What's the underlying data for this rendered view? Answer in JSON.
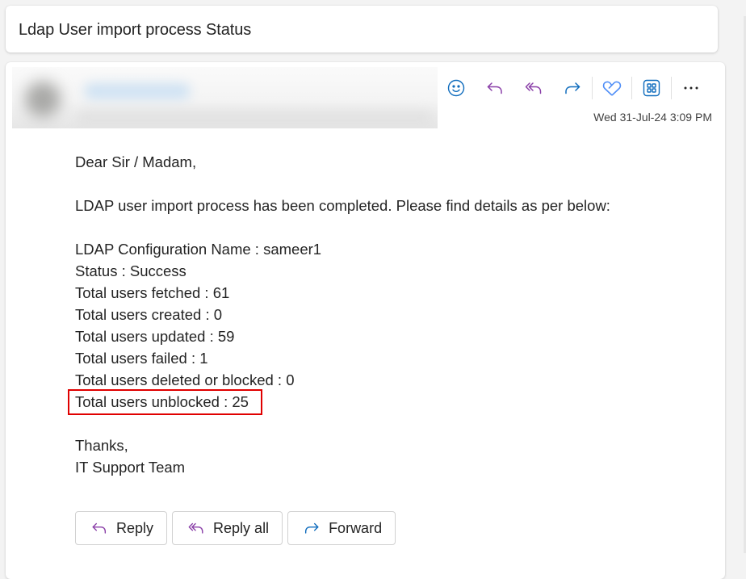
{
  "subject": "Ldap User import process Status",
  "sender": {
    "name": "[redacted]",
    "details": "[redacted]",
    "blurred": true
  },
  "toolbar": {
    "items": [
      {
        "id": "react",
        "icon": "emoji-icon",
        "color": "#0f6cbd"
      },
      {
        "id": "reply",
        "icon": "reply-icon",
        "color": "#8a3fa8"
      },
      {
        "id": "reply-all",
        "icon": "reply-all-icon",
        "color": "#8a3fa8"
      },
      {
        "id": "forward",
        "icon": "forward-icon",
        "color": "#0f6cbd"
      },
      {
        "id": "viva",
        "icon": "heart-check-icon",
        "color": "#4f8ef7"
      },
      {
        "id": "apps",
        "icon": "apps-grid-icon",
        "color": "#0f6cbd"
      },
      {
        "id": "more",
        "icon": "more-icon",
        "color": "#242424"
      }
    ]
  },
  "timestamp": "Wed 31-Jul-24 3:09 PM",
  "body": {
    "greeting": "Dear Sir / Madam,",
    "intro": "LDAP user import process has been completed. Please find details as per below:",
    "details": [
      "LDAP Configuration Name : sameer1",
      "Status : Success",
      "Total users fetched : 61",
      "Total users created : 0",
      "Total users updated : 59",
      "Total users failed : 1",
      "Total users deleted or blocked : 0",
      "Total users unblocked : 25"
    ],
    "highlighted_line": "Total users unblocked : 25",
    "highlight_color": "#e00000",
    "closing": "Thanks,",
    "signature": "IT Support Team"
  },
  "actions": {
    "reply": "Reply",
    "reply_all": "Reply all",
    "forward": "Forward"
  }
}
